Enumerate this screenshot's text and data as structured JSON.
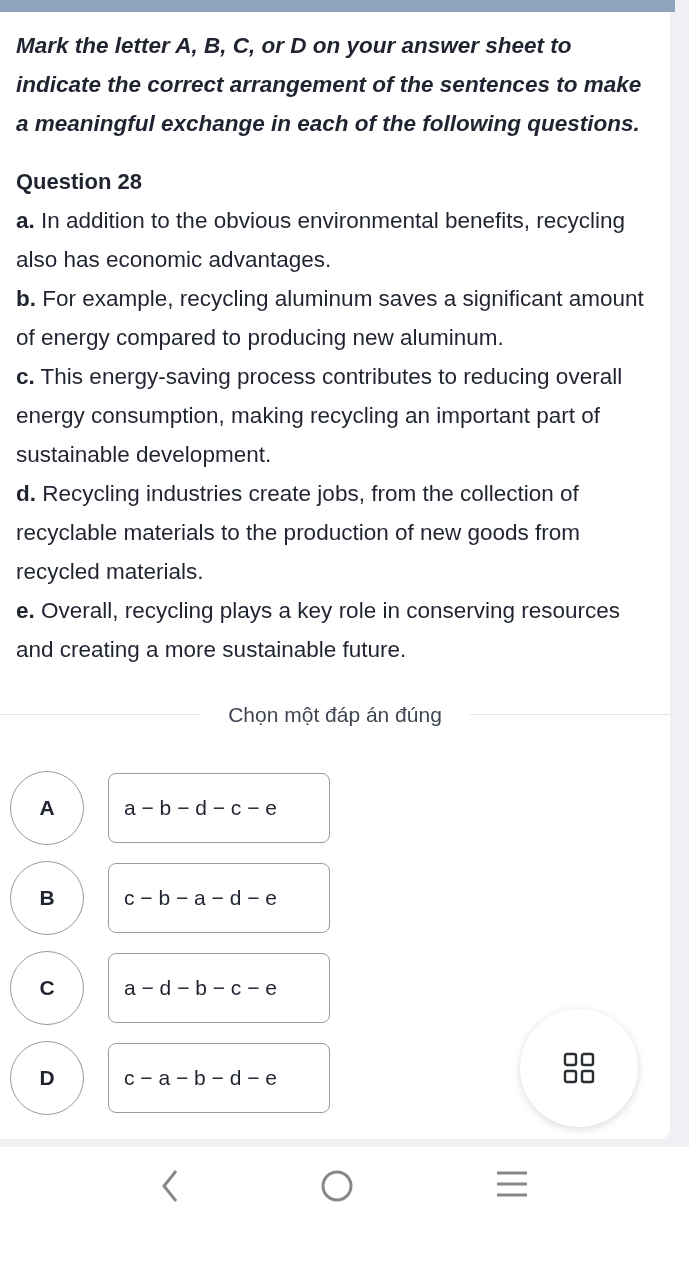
{
  "instruction": "Mark the letter A, B, C, or D on your answer sheet to indicate the correct arrangement of the sentences to make a meaningful exchange in each of the following questions.",
  "question": {
    "title": "Question 28",
    "sentences": [
      "**a.** In addition to the obvious environmental benefits, recycling also has economic advantages.",
      "**b.** For example, recycling aluminum saves a significant amount of energy compared to producing new aluminum.",
      "**c.** This energy-saving process contributes to reducing overall energy consumption, making recycling an important part of sustainable development.",
      "**d.** Recycling industries create jobs, from the collection of recyclable materials to the production of new goods from recycled materials.",
      "**e.** Overall, recycling plays a key role in conserving resources and creating a more sustainable future."
    ]
  },
  "prompt": "Chọn một đáp án đúng",
  "options": [
    {
      "letter": "A",
      "answer": "a − b − d − c − e"
    },
    {
      "letter": "B",
      "answer": "c − b − a − d − e"
    },
    {
      "letter": "C",
      "answer": "a − d − b − c − e"
    },
    {
      "letter": "D",
      "answer": "c − a − b − d − e"
    }
  ]
}
